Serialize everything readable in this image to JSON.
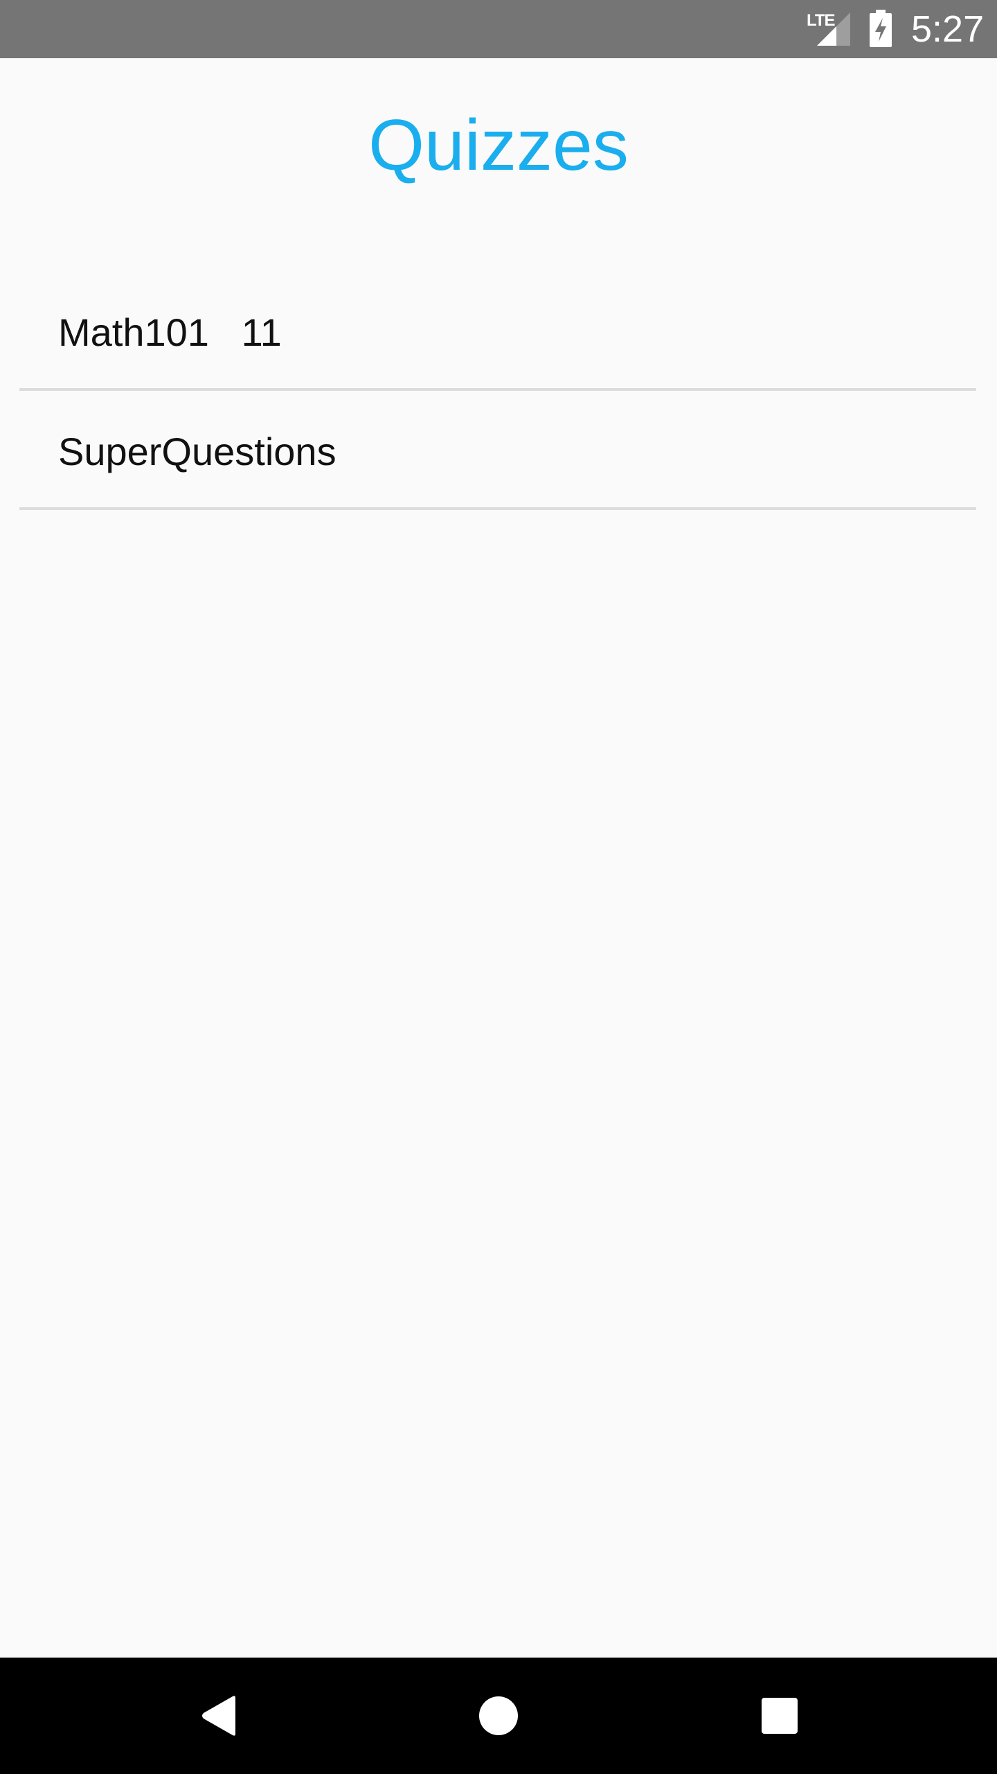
{
  "status_bar": {
    "network": "LTE",
    "time": "5:27",
    "icons": [
      "lte-signal-icon",
      "battery-charging-icon"
    ]
  },
  "header": {
    "title": "Quizzes",
    "title_color": "#1aaeee"
  },
  "quizzes": [
    {
      "label": "Math101   11"
    },
    {
      "label": "SuperQuestions"
    }
  ],
  "nav_bar": {
    "icons": [
      "back-icon",
      "home-icon",
      "recents-icon"
    ]
  }
}
